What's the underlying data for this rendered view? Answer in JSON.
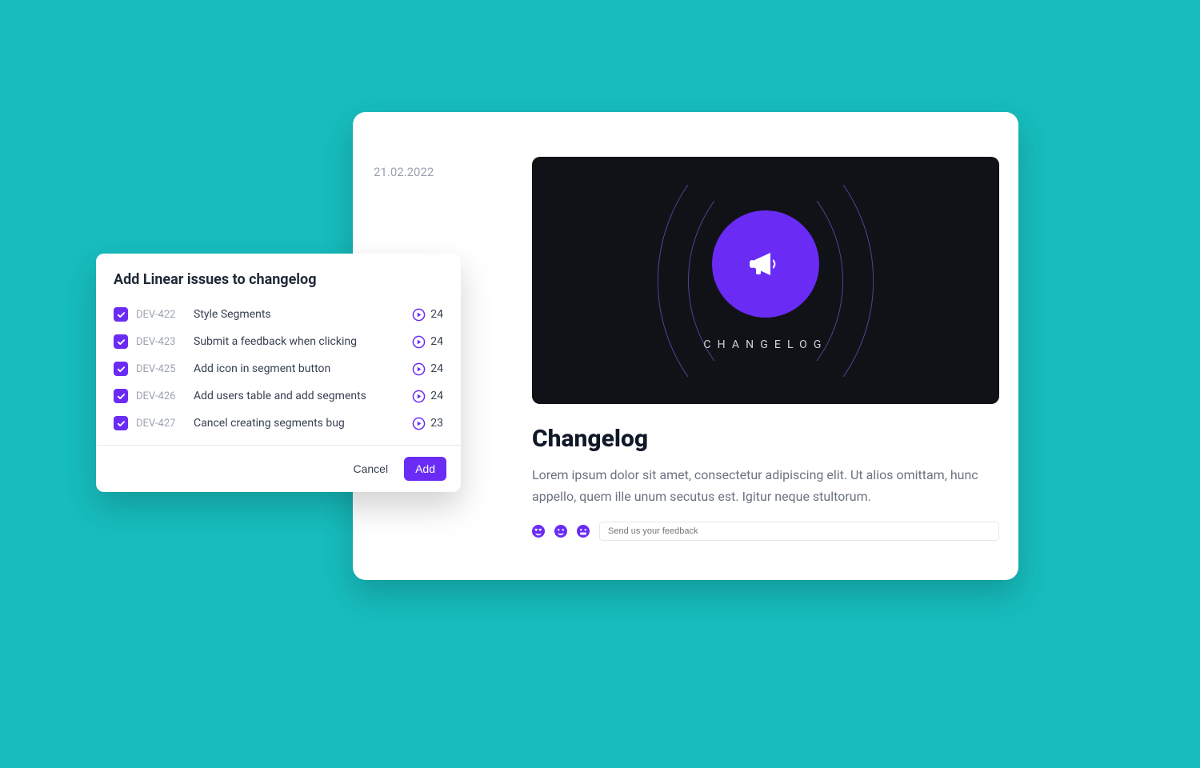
{
  "changelog": {
    "date": "21.02.2022",
    "hero_label": "CHANGELOG",
    "title": "Changelog",
    "body": "Lorem ipsum dolor sit amet, consectetur adipiscing elit. Ut alios omittam, hunc appello, quem ille unum secutus est. Igitur neque stultorum.",
    "feedback_placeholder": "Send us your feedback"
  },
  "modal": {
    "title": "Add Linear issues to changelog",
    "cancel_label": "Cancel",
    "add_label": "Add",
    "issues": [
      {
        "id": "DEV-422",
        "title": "Style Segments",
        "count": "24"
      },
      {
        "id": "DEV-423",
        "title": "Submit a feedback when clicking",
        "count": "24"
      },
      {
        "id": "DEV-425",
        "title": "Add icon in segment button",
        "count": "24"
      },
      {
        "id": "DEV-426",
        "title": "Add users table and add segments",
        "count": "24"
      },
      {
        "id": "DEV-427",
        "title": "Cancel creating segments bug",
        "count": "23"
      }
    ]
  }
}
